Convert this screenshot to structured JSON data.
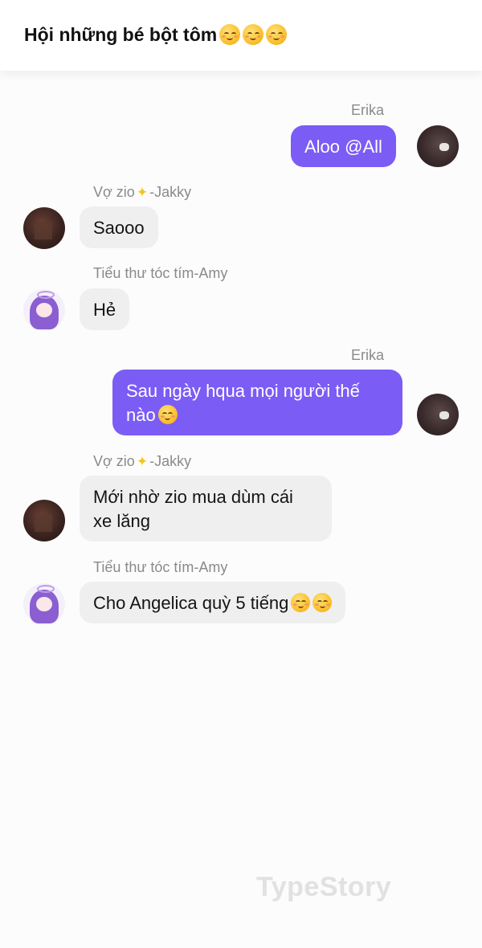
{
  "header": {
    "title": "Hội những bé bột tôm"
  },
  "messages": [
    {
      "sender": "Erika",
      "text": "Aloo @All",
      "direction": "outgoing"
    },
    {
      "sender": "Vợ zio✨ -Jakky",
      "text": "Saooo",
      "direction": "incoming"
    },
    {
      "sender": "Tiểu thư tóc tím-Amy",
      "text": "Hẻ",
      "direction": "incoming"
    },
    {
      "sender": "Erika",
      "text_line1": "Sau ngày hqua mọi người thế",
      "text_line2": "nào",
      "direction": "outgoing"
    },
    {
      "sender": "Vợ zio✨ -Jakky",
      "text_line1": "Mới nhờ zio mua dùm cái",
      "text_line2": "xe lăng",
      "direction": "incoming"
    },
    {
      "sender": "Tiểu thư tóc tím-Amy",
      "text": "Cho Angelica quỳ 5 tiếng",
      "direction": "incoming"
    }
  ],
  "sender_parts": {
    "jakky_prefix": "Vợ zio",
    "jakky_suffix": "-Jakky",
    "sparkle": "✨"
  },
  "watermark": "TypeStory",
  "colors": {
    "outgoing_bubble": "#7b5cf5",
    "incoming_bubble": "#efefef",
    "sender_text": "#8a8a8a"
  },
  "icons": {
    "emoji": "smiling-face-emoji",
    "sparkle": "sparkles-emoji"
  }
}
